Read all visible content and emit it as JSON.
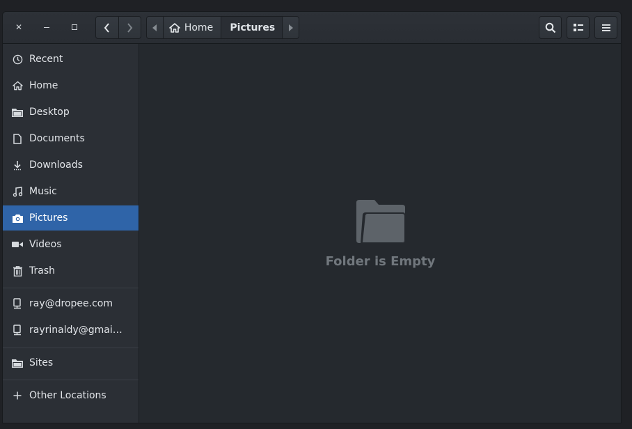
{
  "window": {
    "controls": {
      "close_icon": "close-icon",
      "minimize_icon": "minimize-icon",
      "maximize_icon": "maximize-icon"
    }
  },
  "header": {
    "breadcrumbs": [
      {
        "label": "Home",
        "icon": "home-icon"
      },
      {
        "label": "Pictures",
        "active": true
      }
    ],
    "buttons": {
      "back_icon": "chevron-left-icon",
      "forward_icon": "chevron-right-icon",
      "search_icon": "search-icon",
      "view_icon": "list-view-icon",
      "menu_icon": "hamburger-menu-icon"
    }
  },
  "sidebar": {
    "places": [
      {
        "label": "Recent",
        "icon": "clock-icon"
      },
      {
        "label": "Home",
        "icon": "home-icon"
      },
      {
        "label": "Desktop",
        "icon": "folder-icon"
      },
      {
        "label": "Documents",
        "icon": "document-icon"
      },
      {
        "label": "Downloads",
        "icon": "download-icon"
      },
      {
        "label": "Music",
        "icon": "music-icon"
      },
      {
        "label": "Pictures",
        "icon": "camera-icon",
        "selected": true
      },
      {
        "label": "Videos",
        "icon": "video-icon"
      },
      {
        "label": "Trash",
        "icon": "trash-icon"
      }
    ],
    "accounts": [
      {
        "label": "ray@dropee.com",
        "icon": "network-drive-icon"
      },
      {
        "label": "rayrinaldy@gmai…",
        "icon": "network-drive-icon"
      }
    ],
    "bookmarks": [
      {
        "label": "Sites",
        "icon": "folder-icon"
      }
    ],
    "other": {
      "label": "Other Locations",
      "icon": "plus-icon"
    }
  },
  "content": {
    "empty_message": "Folder is Empty",
    "empty_icon": "folder-open-icon"
  },
  "colors": {
    "selection": "#2f64a8",
    "background": "#25292e",
    "sidebar": "#2b2f35"
  }
}
